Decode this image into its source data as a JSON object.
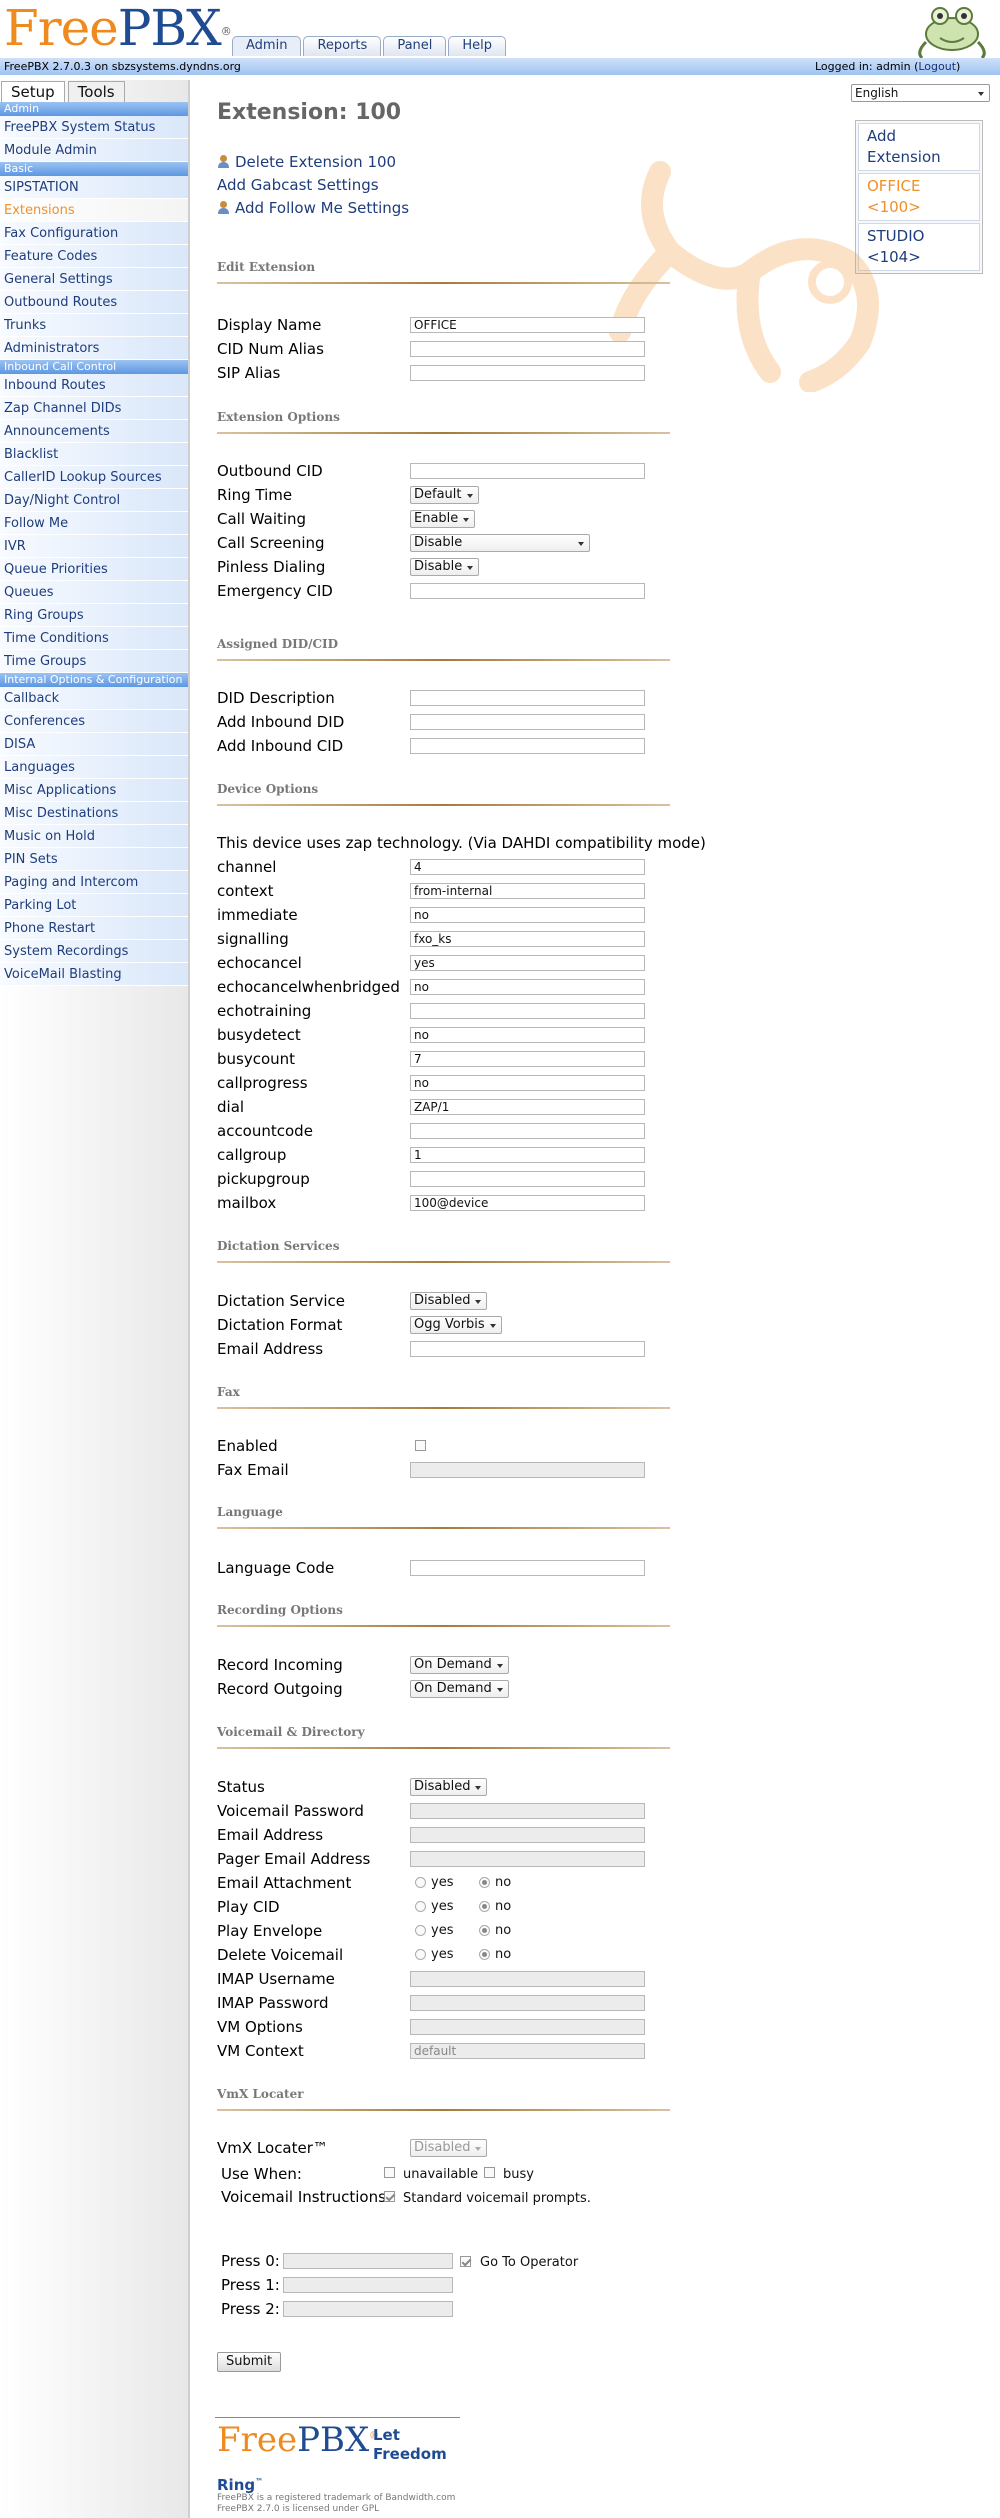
{
  "header": {
    "logo_free": "Free",
    "logo_pbx": "PBX",
    "logo_reg": "®",
    "tabs": [
      "Admin",
      "Reports",
      "Panel",
      "Help"
    ],
    "version_text": "FreePBX 2.7.0.3 on sbzsystems.dyndns.org",
    "login_prefix": "Logged in: admin (",
    "logout": "Logout",
    "login_suffix": ")"
  },
  "sidebar": {
    "tabs": [
      "Setup",
      "Tools"
    ],
    "sections": [
      {
        "title": "Admin",
        "items": [
          "FreePBX System Status",
          "Module Admin"
        ]
      },
      {
        "title": "Basic",
        "items": [
          "SIPSTATION",
          "Extensions",
          "Fax Configuration",
          "Feature Codes",
          "General Settings",
          "Outbound Routes",
          "Trunks",
          "Administrators"
        ]
      },
      {
        "title": "Inbound Call Control",
        "items": [
          "Inbound Routes",
          "Zap Channel DIDs",
          "Announcements",
          "Blacklist",
          "CallerID Lookup Sources",
          "Day/Night Control",
          "Follow Me",
          "IVR",
          "Queue Priorities",
          "Queues",
          "Ring Groups",
          "Time Conditions",
          "Time Groups"
        ]
      },
      {
        "title": "Internal Options & Configuration",
        "items": [
          "Callback",
          "Conferences",
          "DISA",
          "Languages",
          "Misc Applications",
          "Misc Destinations",
          "Music on Hold",
          "PIN Sets",
          "Paging and Intercom",
          "Parking Lot",
          "Phone Restart",
          "System Recordings",
          "VoiceMail Blasting"
        ]
      }
    ],
    "current": "Extensions"
  },
  "language_select": "English",
  "right_box": {
    "add": "Add Extension",
    "items": [
      "OFFICE <100>",
      "STUDIO <104>"
    ],
    "current": "OFFICE <100>"
  },
  "page": {
    "title": "Extension: 100",
    "actions": [
      "Delete Extension 100",
      "Add Gabcast Settings",
      "Add Follow Me Settings"
    ]
  },
  "edit_extension": {
    "heading": "Edit Extension",
    "display_name_label": "Display Name",
    "display_name_value": "OFFICE",
    "cid_num_alias_label": "CID Num Alias",
    "cid_num_alias_value": "",
    "sip_alias_label": "SIP Alias",
    "sip_alias_value": ""
  },
  "extension_options": {
    "heading": "Extension Options",
    "outbound_cid_label": "Outbound CID",
    "outbound_cid_value": "",
    "ring_time_label": "Ring Time",
    "ring_time_value": "Default",
    "call_waiting_label": "Call Waiting",
    "call_waiting_value": "Enable",
    "call_screening_label": "Call Screening",
    "call_screening_value": "Disable",
    "pinless_dialing_label": "Pinless Dialing",
    "pinless_dialing_value": "Disable",
    "emergency_cid_label": "Emergency CID",
    "emergency_cid_value": ""
  },
  "assigned_did": {
    "heading": "Assigned DID/CID",
    "did_description_label": "DID Description",
    "did_description_value": "",
    "add_inbound_did_label": "Add Inbound DID",
    "add_inbound_did_value": "",
    "add_inbound_cid_label": "Add Inbound CID",
    "add_inbound_cid_value": ""
  },
  "device_options": {
    "heading": "Device Options",
    "intro": "This device uses zap technology. (Via DAHDI compatibility mode)",
    "rows": [
      {
        "label": "channel",
        "value": "4"
      },
      {
        "label": "context",
        "value": "from-internal"
      },
      {
        "label": "immediate",
        "value": "no"
      },
      {
        "label": "signalling",
        "value": "fxo_ks"
      },
      {
        "label": "echocancel",
        "value": "yes"
      },
      {
        "label": "echocancelwhenbridged",
        "value": "no"
      },
      {
        "label": "echotraining",
        "value": ""
      },
      {
        "label": "busydetect",
        "value": "no"
      },
      {
        "label": "busycount",
        "value": "7"
      },
      {
        "label": "callprogress",
        "value": "no"
      },
      {
        "label": "dial",
        "value": "ZAP/1"
      },
      {
        "label": "accountcode",
        "value": ""
      },
      {
        "label": "callgroup",
        "value": "1"
      },
      {
        "label": "pickupgroup",
        "value": ""
      },
      {
        "label": "mailbox",
        "value": "100@device"
      }
    ]
  },
  "dictation": {
    "heading": "Dictation Services",
    "service_label": "Dictation Service",
    "service_value": "Disabled",
    "format_label": "Dictation Format",
    "format_value": "Ogg Vorbis",
    "email_label": "Email Address",
    "email_value": ""
  },
  "fax": {
    "heading": "Fax",
    "enabled_label": "Enabled",
    "email_label": "Fax Email",
    "email_value": ""
  },
  "language": {
    "heading": "Language",
    "code_label": "Language Code",
    "code_value": ""
  },
  "recording": {
    "heading": "Recording Options",
    "incoming_label": "Record Incoming",
    "incoming_value": "On Demand",
    "outgoing_label": "Record Outgoing",
    "outgoing_value": "On Demand"
  },
  "voicemail": {
    "heading": "Voicemail & Directory",
    "status_label": "Status",
    "status_value": "Disabled",
    "password_label": "Voicemail Password",
    "password_value": "",
    "email_label": "Email Address",
    "email_value": "",
    "pager_label": "Pager Email Address",
    "pager_value": "",
    "yes": "yes",
    "no": "no",
    "attachment_label": "Email Attachment",
    "play_cid_label": "Play CID",
    "play_envelope_label": "Play Envelope",
    "delete_label": "Delete Voicemail",
    "imap_user_label": "IMAP Username",
    "imap_user_value": "",
    "imap_pass_label": "IMAP Password",
    "imap_pass_value": "",
    "vm_options_label": "VM Options",
    "vm_options_value": "",
    "vm_context_label": "VM Context",
    "vm_context_value": "default"
  },
  "vmx": {
    "heading": "VmX Locater",
    "locater_label": "VmX Locater™",
    "locater_value": "Disabled",
    "use_when_label": "Use When:",
    "unavailable": "unavailable",
    "busy": "busy",
    "instructions_label": "Voicemail Instructions:",
    "instructions_text": "Standard voicemail prompts.",
    "press0_label": "Press 0:",
    "press0_value": "",
    "go_to_operator": "Go To Operator",
    "press1_label": "Press 1:",
    "press1_value": "",
    "press2_label": "Press 2:",
    "press2_value": ""
  },
  "submit": "Submit",
  "footer": {
    "logo_free": "Free",
    "logo_pbx": "PBX",
    "logo_reg": "®",
    "tag1": "Let",
    "tag2": "Freedom",
    "tag3": "Ring",
    "tag_tm": "™",
    "line1": "FreePBX is a registered trademark of Bandwidth.com",
    "line2": "FreePBX 2.7.0 is licensed under GPL"
  }
}
